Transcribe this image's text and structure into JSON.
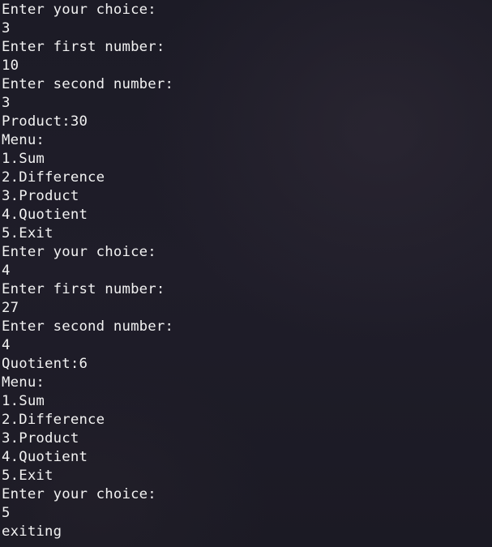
{
  "terminal": {
    "lines": [
      "Enter your choice:",
      "3",
      "Enter first number:",
      "10",
      "Enter second number:",
      "3",
      "Product:30",
      "Menu:",
      "1.Sum",
      "2.Difference",
      "3.Product",
      "4.Quotient",
      "5.Exit",
      "Enter your choice:",
      "4",
      "Enter first number:",
      "27",
      "Enter second number:",
      "4",
      "Quotient:6",
      "Menu:",
      "1.Sum",
      "2.Difference",
      "3.Product",
      "4.Quotient",
      "5.Exit",
      "Enter your choice:",
      "5",
      "exiting"
    ],
    "text_color": "#f2f2f2",
    "background_color": "#1e1c27"
  }
}
